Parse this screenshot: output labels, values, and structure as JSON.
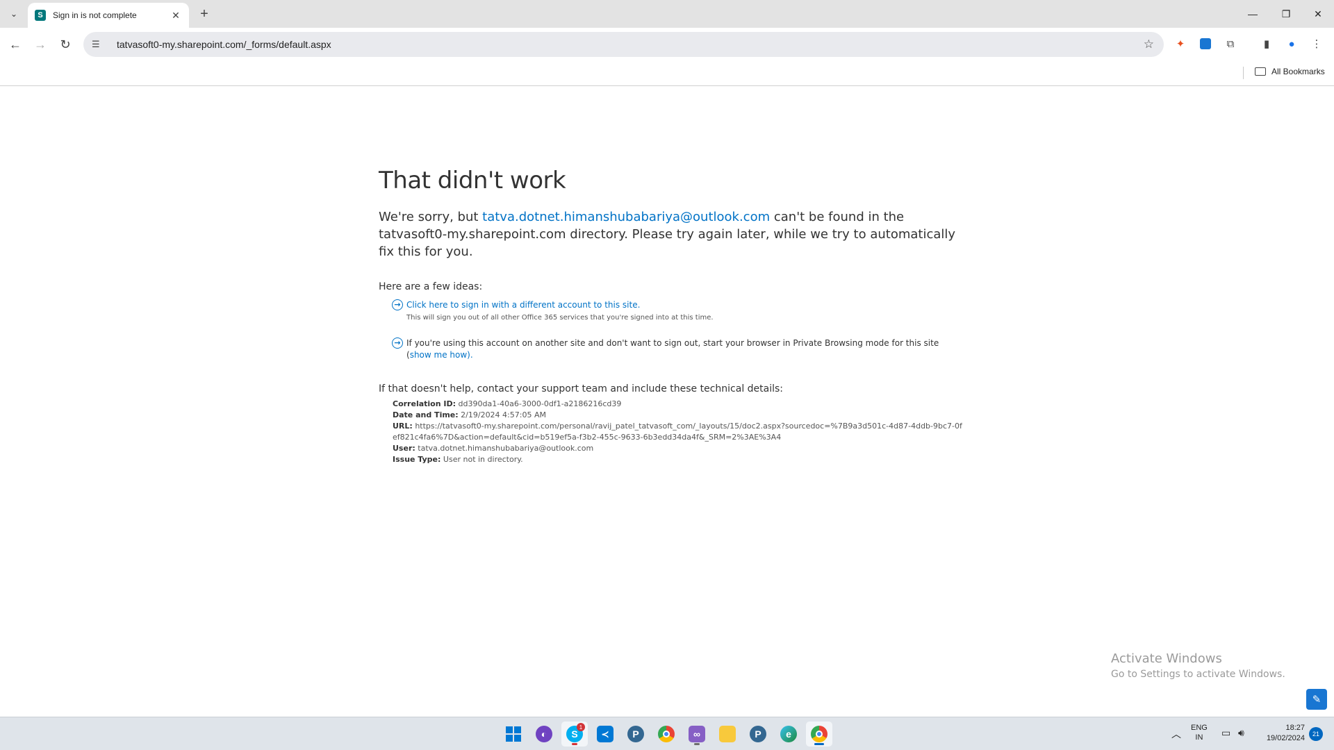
{
  "browser": {
    "tab": {
      "title": "Sign in is not complete",
      "favicon": "S"
    },
    "address": {
      "url": "tatvasoft0-my.sharepoint.com/_forms/default.aspx"
    },
    "bookmarks": {
      "all_label": "All Bookmarks"
    }
  },
  "page": {
    "title": "That didn't work",
    "lead_prefix": "We're sorry, but ",
    "lead_email": "tatva.dotnet.himanshubabariya@outlook.com",
    "lead_suffix": " can't be found in the tatvasoft0-my.sharepoint.com directory. Please try again later, while we try to automatically fix this for you.",
    "ideas_heading": "Here are a few ideas:",
    "idea1_link": "Click here to sign in with a different account to this site.",
    "idea1_sub": "This will sign you out of all other Office 365 services that you're signed into at this time.",
    "idea2_text": "If you're using this account on another site and don't want to sign out, start your browser in Private Browsing mode for this site (",
    "idea2_link": "show me how",
    "idea2_end": ").",
    "help_heading": "If that doesn't help, contact your support team and include these technical details:",
    "details": {
      "correlation_label": "Correlation ID:",
      "correlation_value": "dd390da1-40a6-3000-0df1-a2186216cd39",
      "datetime_label": "Date and Time:",
      "datetime_value": "2/19/2024 4:57:05 AM",
      "url_label": "URL:",
      "url_value": "https://tatvasoft0-my.sharepoint.com/personal/ravij_patel_tatvasoft_com/_layouts/15/doc2.aspx?sourcedoc=%7B9a3d501c-4d87-4ddb-9bc7-0fef821c4fa6%7D&action=default&cid=b519ef5a-f3b2-455c-9633-6b3edd34da4f&_SRM=2%3AE%3A4",
      "user_label": "User:",
      "user_value": "tatva.dotnet.himanshubabariya@outlook.com",
      "issue_label": "Issue Type:",
      "issue_value": "User not in directory."
    }
  },
  "watermark": {
    "title": "Activate Windows",
    "subtitle": "Go to Settings to activate Windows."
  },
  "taskbar": {
    "lang_line1": "ENG",
    "lang_line2": "IN",
    "time": "18:27",
    "date": "19/02/2024",
    "notification_count": "21",
    "skype_badge": "1",
    "colors": {
      "accent": "#0067c0",
      "link": "#0072c6"
    }
  }
}
